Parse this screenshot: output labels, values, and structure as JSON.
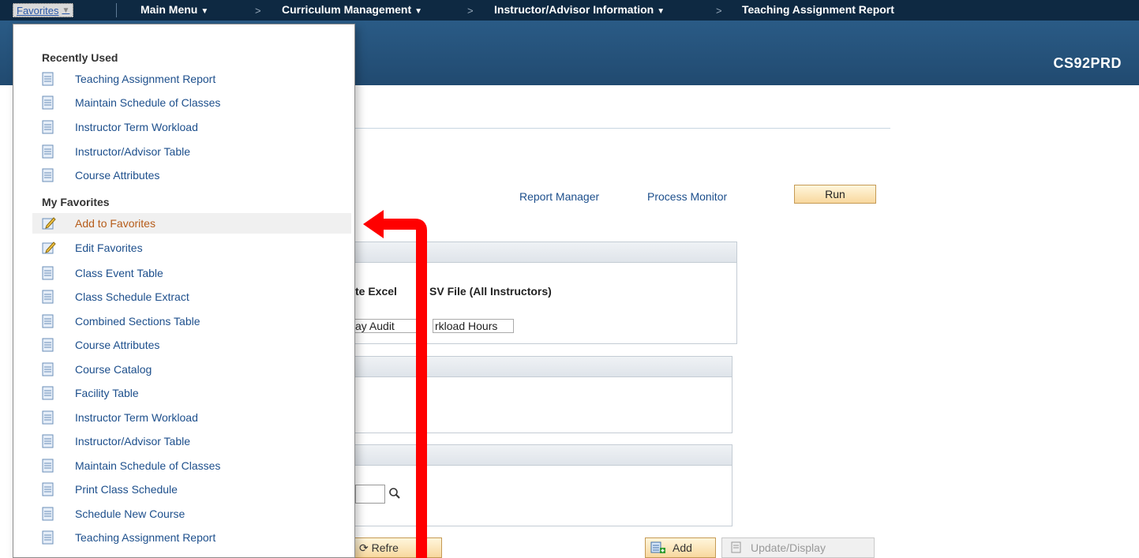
{
  "topnav": {
    "favorites": "Favorites",
    "main_menu": "Main Menu",
    "curriculum": "Curriculum Management",
    "instructor_info": "Instructor/Advisor Information",
    "current_page": "Teaching Assignment Report"
  },
  "header": {
    "environment": "CS92PRD"
  },
  "actions": {
    "report_manager": "Report Manager",
    "process_monitor": "Process Monitor",
    "run": "Run"
  },
  "panel1": {
    "option_text": "te Excel",
    "option_text2": "SV File (All Instructors)",
    "checkbox_label": "ay Audit",
    "checkbox_label2": "rkload Hours"
  },
  "buttons": {
    "refresh": "Refre",
    "add": "Add",
    "update_display": "Update/Display"
  },
  "dropdown": {
    "recently_used_title": "Recently Used",
    "recently_used": [
      "Teaching Assignment Report",
      "Maintain Schedule of Classes",
      "Instructor Term Workload",
      "Instructor/Advisor Table",
      "Course Attributes"
    ],
    "my_favorites_title": "My Favorites",
    "favorites_actions": [
      "Add to Favorites",
      "Edit Favorites"
    ],
    "favorites": [
      "Class Event Table",
      "Class Schedule Extract",
      "Combined Sections Table",
      "Course Attributes",
      "Course Catalog",
      "Facility Table",
      "Instructor Term Workload",
      "Instructor/Advisor Table",
      "Maintain Schedule of Classes",
      "Print Class Schedule",
      "Schedule New Course",
      "Teaching Assignment Report"
    ]
  },
  "icons": {
    "page": "page-icon",
    "edit": "pencil-icon",
    "lookup": "magnifier-icon"
  },
  "colors": {
    "nav": "#0e2942",
    "header": "#2a5b86",
    "link": "#1d4f8c",
    "annotation": "#ff0000"
  }
}
